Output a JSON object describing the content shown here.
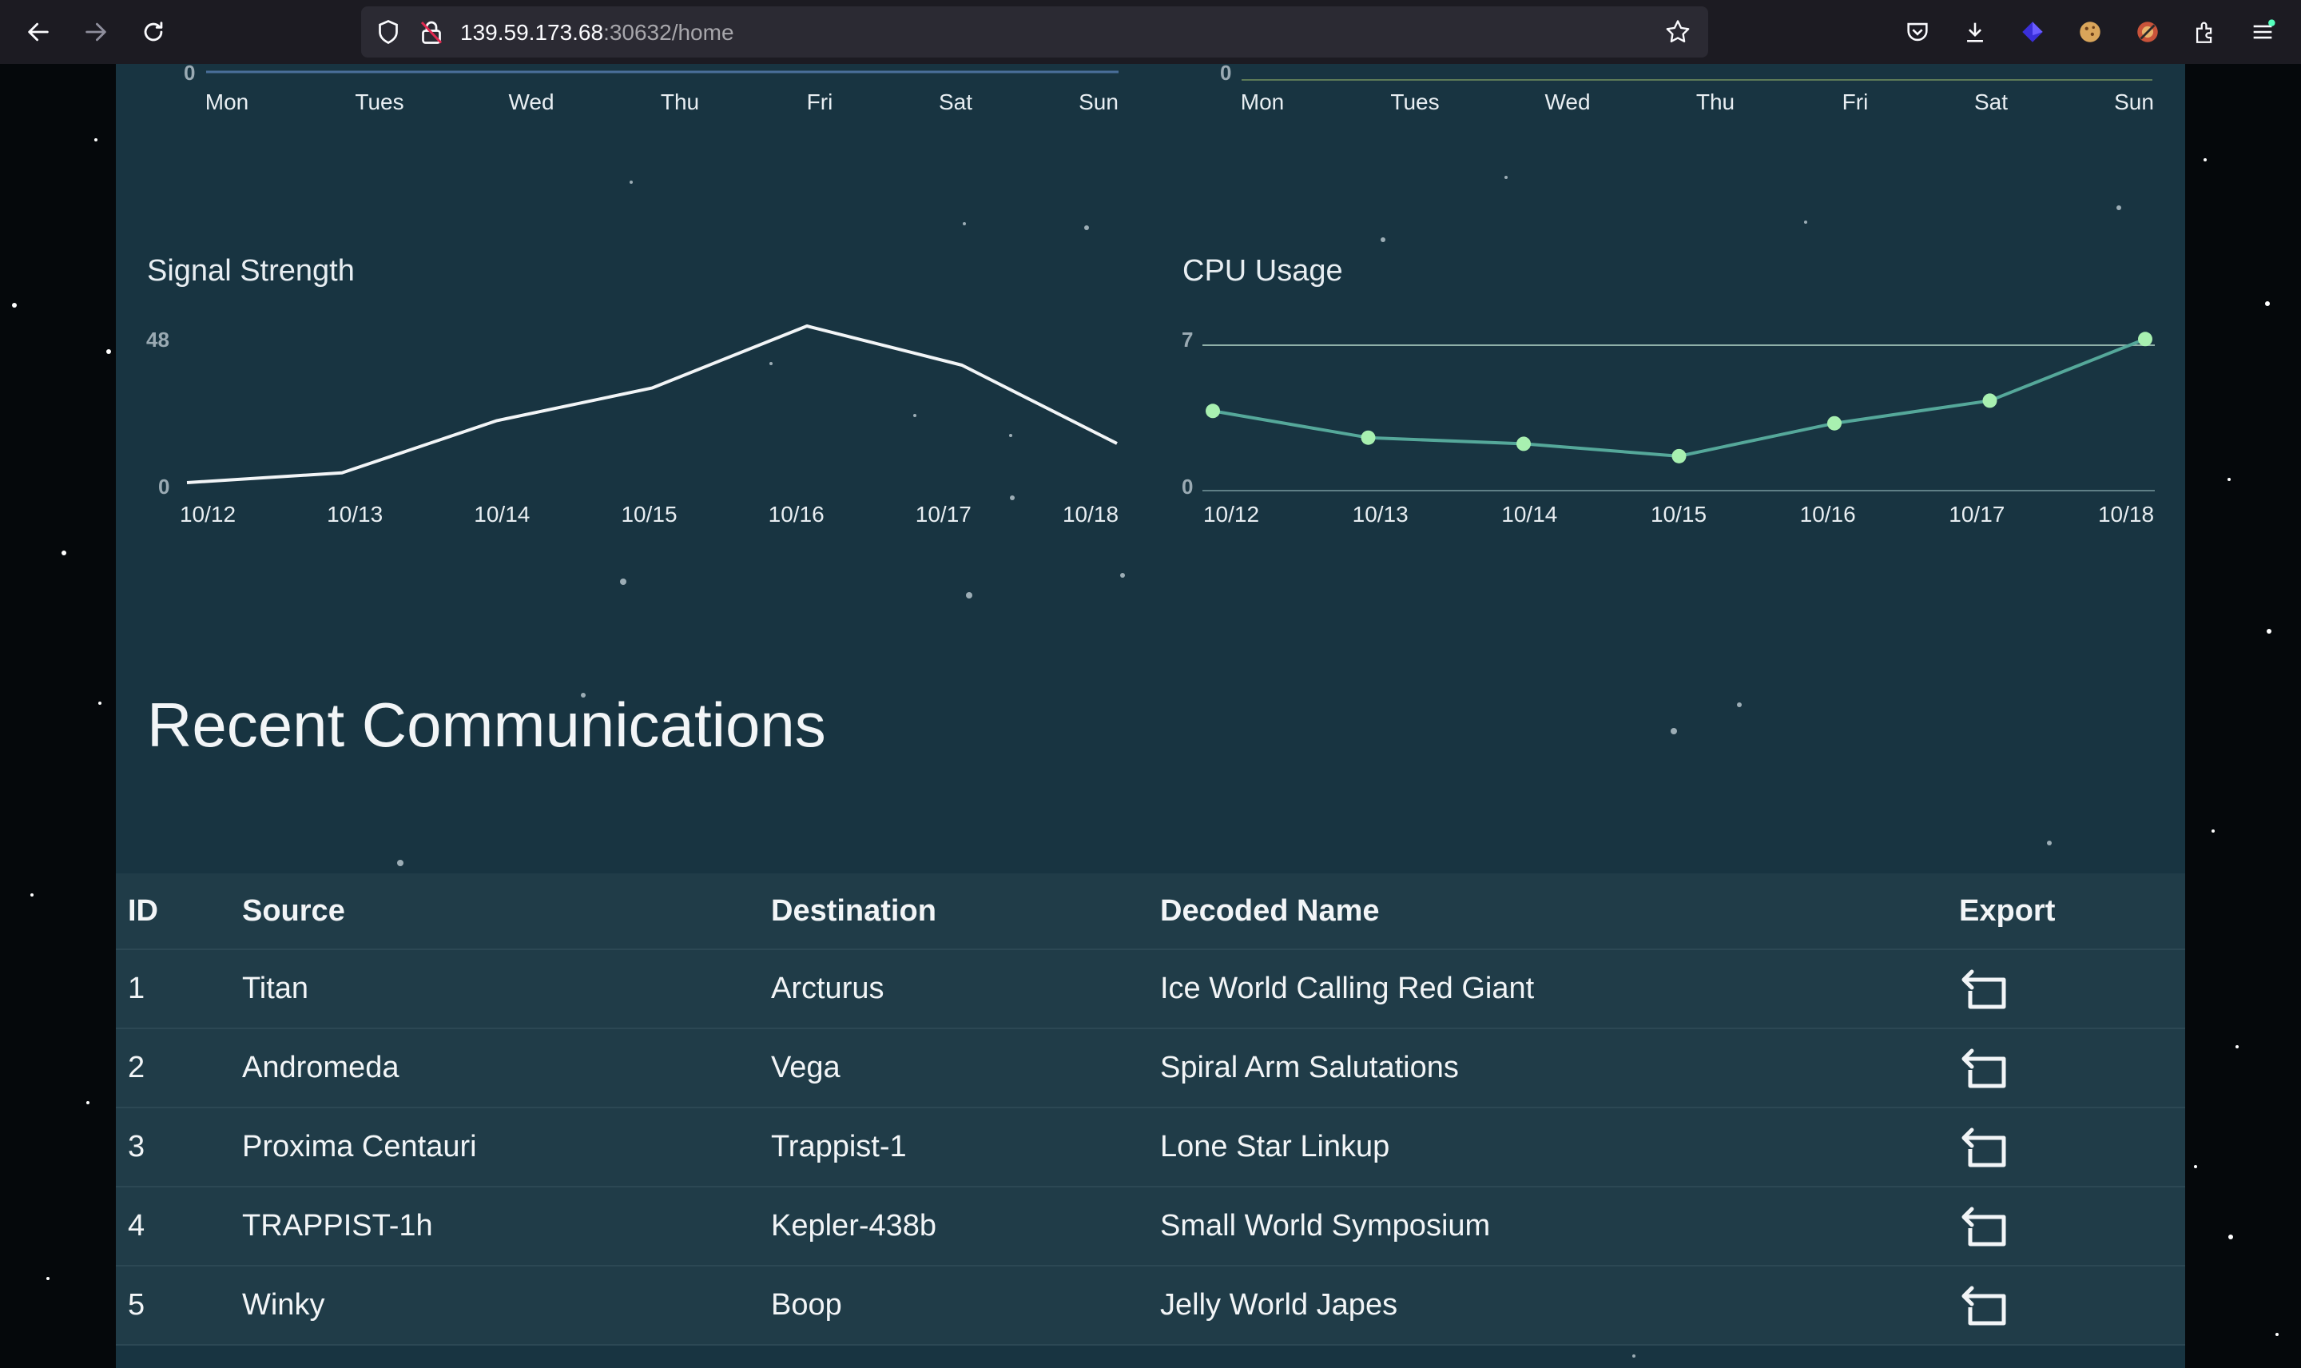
{
  "browser": {
    "url_host": "139.59.173.68",
    "url_path": ":30632/home"
  },
  "top_charts": {
    "left": {
      "zero": "0",
      "days": [
        "Mon",
        "Tues",
        "Wed",
        "Thu",
        "Fri",
        "Sat",
        "Sun"
      ]
    },
    "right": {
      "zero": "0",
      "days": [
        "Mon",
        "Tues",
        "Wed",
        "Thu",
        "Fri",
        "Sat",
        "Sun"
      ]
    }
  },
  "chart_data": [
    {
      "type": "line",
      "title": "Signal Strength",
      "x": [
        "10/12",
        "10/13",
        "10/14",
        "10/15",
        "10/16",
        "10/17",
        "10/18"
      ],
      "series": [
        {
          "values": [
            0,
            3,
            19,
            29,
            48,
            36,
            12
          ]
        }
      ],
      "ylim": [
        0,
        48
      ],
      "y_ticks": [
        "48",
        "0"
      ],
      "color": "#f2f5f7"
    },
    {
      "type": "line",
      "title": "CPU Usage",
      "x": [
        "10/12",
        "10/13",
        "10/14",
        "10/15",
        "10/16",
        "10/17",
        "10/18"
      ],
      "series": [
        {
          "values": [
            3.8,
            2.5,
            2.2,
            1.6,
            3.2,
            4.3,
            7.3
          ]
        }
      ],
      "ylim": [
        0,
        7
      ],
      "y_ticks": [
        "7",
        "0"
      ],
      "color": "#55a89a",
      "marker_color": "#a8f0b0"
    }
  ],
  "communications": {
    "title": "Recent Communications",
    "columns": [
      "ID",
      "Source",
      "Destination",
      "Decoded Name",
      "Export"
    ],
    "rows": [
      {
        "id": "1",
        "source": "Titan",
        "destination": "Arcturus",
        "name": "Ice World Calling Red Giant"
      },
      {
        "id": "2",
        "source": "Andromeda",
        "destination": "Vega",
        "name": "Spiral Arm Salutations"
      },
      {
        "id": "3",
        "source": "Proxima Centauri",
        "destination": "Trappist-1",
        "name": "Lone Star Linkup"
      },
      {
        "id": "4",
        "source": "TRAPPIST-1h",
        "destination": "Kepler-438b",
        "name": "Small World Symposium"
      },
      {
        "id": "5",
        "source": "Winky",
        "destination": "Boop",
        "name": "Jelly World Japes"
      }
    ]
  },
  "icons": {
    "back": "back-arrow-icon",
    "forward": "forward-arrow-icon",
    "reload": "reload-icon",
    "export": "export-icon"
  }
}
